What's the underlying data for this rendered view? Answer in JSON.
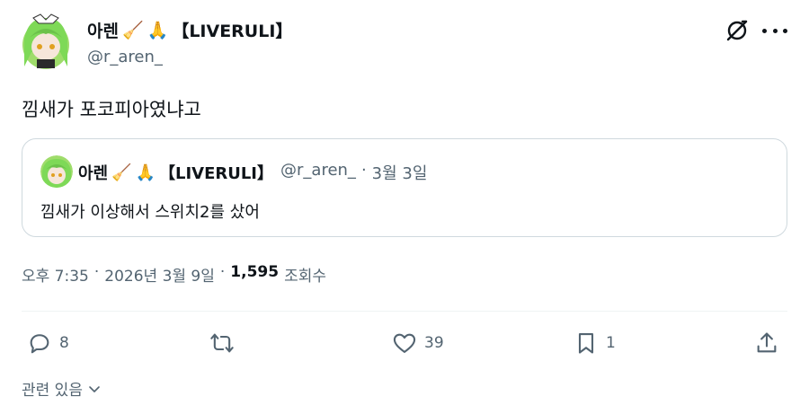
{
  "author": {
    "name": "아렌",
    "emoji": "🧹",
    "hands_emoji": "🙏",
    "tag": "【LIVERULI】",
    "handle": "@r_aren_"
  },
  "tweet": {
    "text": "낌새가 포코피아였냐고"
  },
  "quote": {
    "name": "아렌",
    "emoji": "🧹",
    "hands_emoji": "🙏",
    "tag": "【LIVERULI】",
    "handle": "@r_aren_",
    "separator": "·",
    "date": "3월 3일",
    "text": "낌새가 이상해서 스위치2를 샀어"
  },
  "meta": {
    "time": "오후 7:35",
    "sep1": "·",
    "date": "2026년 3월 9일",
    "sep2": "·",
    "views": "1,595",
    "views_label": "조회수"
  },
  "actions": {
    "replies": "8",
    "retweets": "",
    "likes": "39",
    "bookmarks": "1"
  },
  "reply_settings": {
    "label": "관련 있음"
  },
  "colors": {
    "text": "#0f1419",
    "secondary": "#536471",
    "border": "#cfd9de",
    "avatar_hair": "#7ed957"
  }
}
